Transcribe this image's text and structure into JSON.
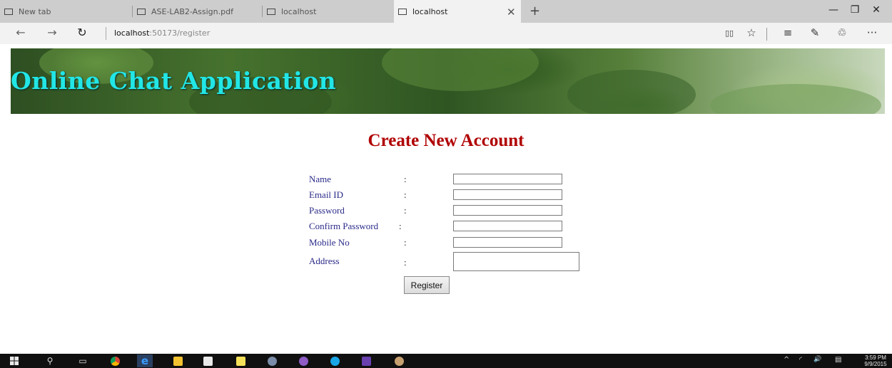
{
  "browser": {
    "tabs": [
      {
        "label": "New tab",
        "active": false
      },
      {
        "label": "ASE-LAB2-Assign.pdf",
        "active": false
      },
      {
        "label": "localhost",
        "active": false
      },
      {
        "label": "localhost",
        "active": true
      }
    ],
    "close_tab_glyph": "✕",
    "new_tab_glyph": "+",
    "window_controls": {
      "minimize": "—",
      "restore": "❐",
      "close": "✕"
    },
    "nav": {
      "back": "←",
      "forward": "→",
      "refresh": "↻"
    },
    "url_host": "localhost",
    "url_rest": ":50173/register",
    "toolbar": {
      "reading_view": "▯▯",
      "favorites": "☆",
      "hub": "≡",
      "web_note": "✎",
      "share": "♲",
      "more": "···"
    }
  },
  "banner": {
    "title": "Online Chat Application"
  },
  "form": {
    "heading": "Create New Account",
    "colon": ":",
    "fields": [
      {
        "label": "Name",
        "value": ""
      },
      {
        "label": "Email ID",
        "value": ""
      },
      {
        "label": "Password",
        "value": ""
      },
      {
        "label": "Confirm Password",
        "value": ""
      },
      {
        "label": "Mobile No",
        "value": ""
      },
      {
        "label": "Address",
        "value": ""
      }
    ],
    "submit_label": "Register"
  },
  "taskbar": {
    "start_icon": "windows-logo",
    "search_glyph": "⚲",
    "task_view_glyph": "▭",
    "clock_time": "3:59 PM",
    "clock_date": "9/9/2015",
    "tray": {
      "chevron": "^",
      "wifi": "◜",
      "volume": "🔊",
      "notifications": "▤"
    }
  },
  "colors": {
    "banner_title": "#22e6e6",
    "heading": "#b00000",
    "label": "#2a2a8a"
  }
}
